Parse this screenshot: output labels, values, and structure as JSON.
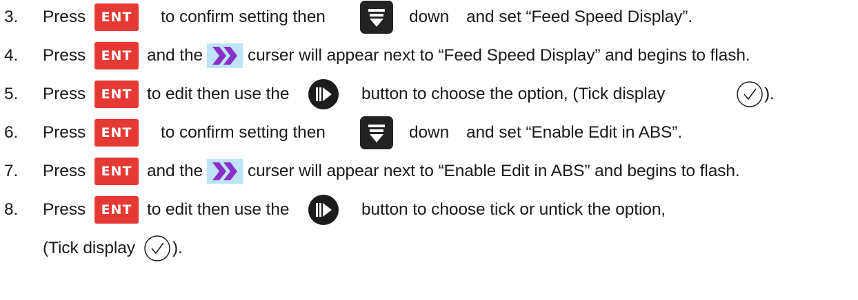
{
  "buttons": {
    "ent_label": "ENT",
    "down_icon": "down-arrow-icon",
    "cursor_icon": "double-chevron-cursor-icon",
    "toggle_icon": "toggle-play-icon",
    "tick_icon": "tick-circle-icon"
  },
  "colors": {
    "ent_red": "#e53a33",
    "dark_button": "#222222",
    "cursor_purple": "#8b2fc9",
    "cursor_bg": "#bfe4f7"
  },
  "steps": [
    {
      "number": "3.",
      "parts": [
        "Press",
        "to confirm setting then",
        "down",
        "and set “Feed Speed Display”."
      ]
    },
    {
      "number": "4.",
      "parts": [
        "Press",
        "and the",
        "curser will appear next to “Feed Speed Display” and begins to flash."
      ]
    },
    {
      "number": "5.",
      "parts": [
        "Press",
        "to edit then use the",
        "button to choose the option, (Tick display",
        ")."
      ]
    },
    {
      "number": "6.",
      "parts": [
        "Press",
        "to confirm setting then",
        "down",
        "and set “Enable Edit in ABS”."
      ]
    },
    {
      "number": "7.",
      "parts": [
        "Press",
        "and the",
        "curser will appear next to “Enable Edit in ABS” and begins to flash."
      ]
    },
    {
      "number": "8.",
      "parts": [
        "Press",
        "to edit then use the",
        "button to choose tick or untick the option,"
      ]
    }
  ],
  "continuation": {
    "parts": [
      "(Tick display",
      ")."
    ]
  }
}
